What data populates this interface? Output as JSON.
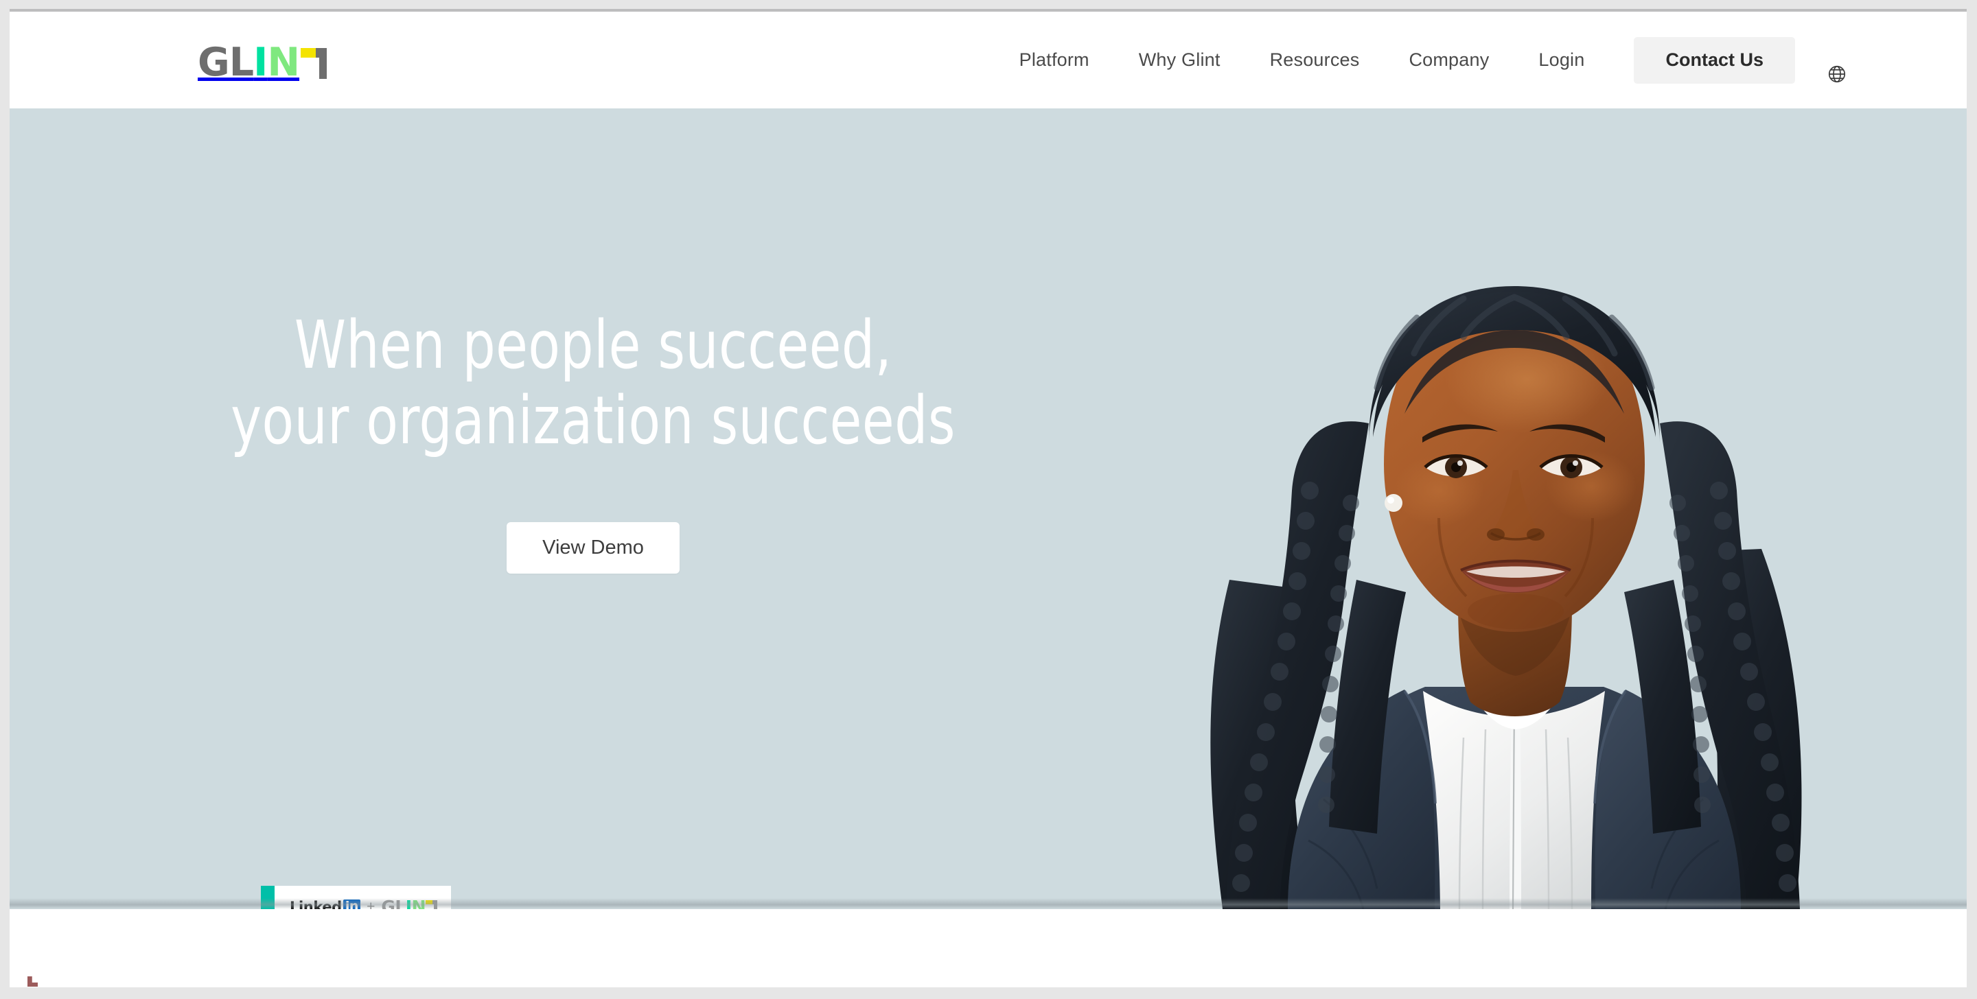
{
  "browser": {
    "chrome_bar": "",
    "viewport_bg": "#e6e6e6"
  },
  "header": {
    "logo": {
      "name": "GLINT",
      "part_gl": "GL",
      "part_i": "I",
      "part_n": "N",
      "part_t": "T",
      "colors": {
        "gray": "#6e6e6e",
        "teal": "#00e1a0",
        "green": "#7fe87f",
        "yellow": "#f4e300"
      }
    },
    "nav_items": [
      {
        "label": "Platform",
        "name": "nav-platform"
      },
      {
        "label": "Why Glint",
        "name": "nav-why-glint"
      },
      {
        "label": "Resources",
        "name": "nav-resources"
      },
      {
        "label": "Company",
        "name": "nav-company"
      },
      {
        "label": "Login",
        "name": "nav-login"
      }
    ],
    "contact_button": "Contact Us",
    "language_icon": "globe-icon",
    "background": "#ffffff"
  },
  "hero": {
    "background": "#cedbdf",
    "heading_line1": "When people succeed,",
    "heading_line2": "your organization succeeds",
    "heading_full": "When people succeed,\nyour organization succeeds",
    "cta_label": "View Demo",
    "heading_color": "#ffffff",
    "partner_badge": {
      "linkedin_text": "Linked",
      "linkedin_mark": "in",
      "plus": "+",
      "glint_gl": "GL",
      "glint_i": "I",
      "glint_n": "N",
      "glint_t": "T",
      "accent_color": "#00bfa8",
      "linkedin_blue": "#0a66c2"
    },
    "portrait_alt": "Smiling professional woman with long box braids wearing a navy blazer over a white blouse"
  },
  "next_section": {
    "background": "#ffffff"
  }
}
